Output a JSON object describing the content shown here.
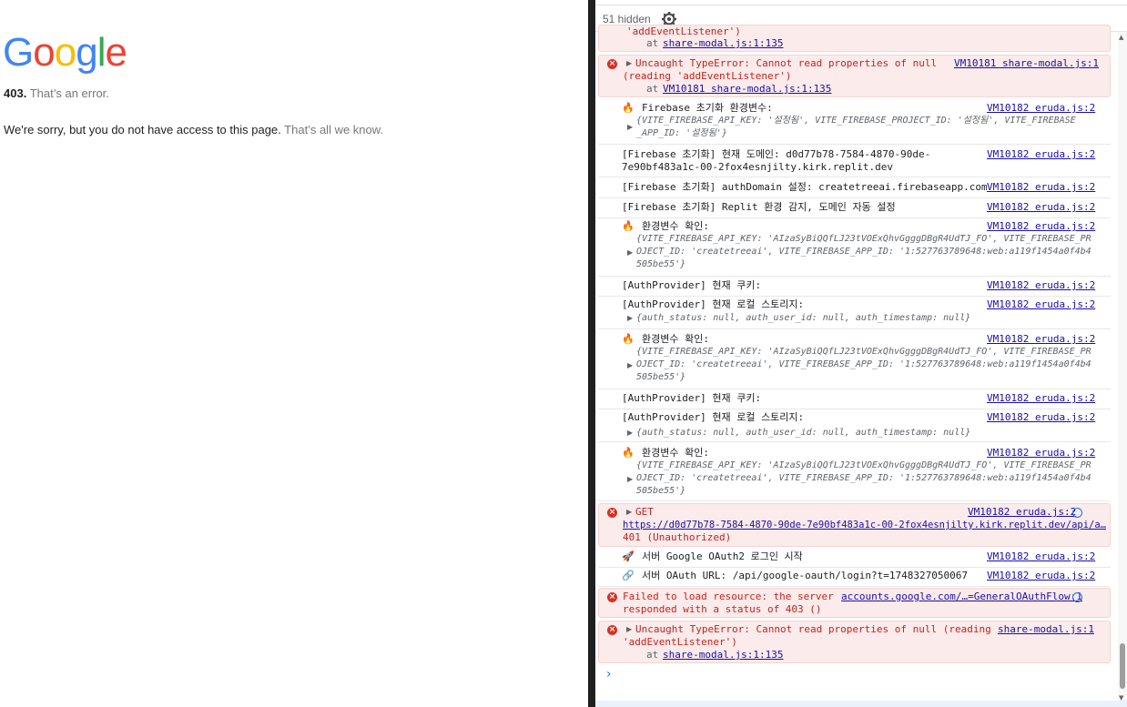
{
  "google_page": {
    "logo_letters": [
      {
        "ch": "G",
        "color": "#4285F4"
      },
      {
        "ch": "o",
        "color": "#EA4335"
      },
      {
        "ch": "o",
        "color": "#FBBC05"
      },
      {
        "ch": "g",
        "color": "#4285F4"
      },
      {
        "ch": "l",
        "color": "#34A853"
      },
      {
        "ch": "e",
        "color": "#EA4335"
      }
    ],
    "code": "403.",
    "error_text": "That’s an error.",
    "sorry_text": "We're sorry, but you do not have access to this page.",
    "all_we_know": "That’s all we know."
  },
  "devtools": {
    "hidden_count": "51 hidden",
    "prompt": "›",
    "messages": [
      {
        "lines": [
          "'addEventListener')",
          "at share-modal.js:1:135"
        ]
      },
      {
        "text1": "Uncaught TypeError: Cannot read properties of null",
        "text2": "(reading 'addEventListener')",
        "at": "at",
        "at_link": "VM10181 share-modal.js:1:135",
        "src": "VM10181 share-modal.js:1"
      },
      {
        "text": "Firebase 초기화 환경변수:",
        "obj1": "{VITE_FIREBASE_API_KEY: '설정됨', VITE_FIREBASE_PROJECT_ID: '설정됨', VITE_FIREBASE",
        "obj2": "_APP_ID: '설정됨'}",
        "src": "VM10182 eruda.js:2"
      },
      {
        "text1": "[Firebase 초기화] 현재 도메인: d0d77b78-7584-4870-90de-",
        "text2": "7e90bf483a1c-00-2fox4esnjilty.kirk.replit.dev",
        "src": "VM10182 eruda.js:2"
      },
      {
        "text": "[Firebase 초기화] authDomain 설정: createtreeai.firebaseapp.com",
        "src": "VM10182 eruda.js:2"
      },
      {
        "text": "[Firebase 초기화] Replit 환경 감지, 도메인 자동 설정",
        "src": "VM10182 eruda.js:2"
      },
      {
        "text": "환경변수 확인:",
        "obj1": "{VITE_FIREBASE_API_KEY: 'AIzaSyBiQQfLJ23tVOExQhvGgggDBgR4UdTJ_FO', VITE_FIREBASE_PR",
        "obj2": "OJECT_ID: 'createtreeai', VITE_FIREBASE_APP_ID: '1:527763789648:web:a119f1454a0f4b4",
        "obj3": "505be55'}",
        "src": "VM10182 eruda.js:2"
      },
      {
        "text": "[AuthProvider] 현재 쿠키:",
        "src": "VM10182 eruda.js:2"
      },
      {
        "text": "[AuthProvider] 현재 로컬 스토리지:",
        "obj1": "{auth_status: null, auth_user_id: null, auth_timestamp: null}",
        "src": "VM10182 eruda.js:2"
      },
      {
        "text": "환경변수 확인:",
        "obj1": "{VITE_FIREBASE_API_KEY: 'AIzaSyBiQQfLJ23tVOExQhvGgggDBgR4UdTJ_FO', VITE_FIREBASE_PR",
        "obj2": "OJECT_ID: 'createtreeai', VITE_FIREBASE_APP_ID: '1:527763789648:web:a119f1454a0f4b4",
        "obj3": "505be55'}",
        "src": "VM10182 eruda.js:2"
      },
      {
        "text": "[AuthProvider] 현재 쿠키:",
        "src": "VM10182 eruda.js:2"
      },
      {
        "text": "[AuthProvider] 현재 로컬 스토리지:",
        "obj1": "{auth_status: null, auth_user_id: null, auth_timestamp: null}",
        "src": "VM10182 eruda.js:2"
      },
      {
        "text": "환경변수 확인:",
        "obj1": "{VITE_FIREBASE_API_KEY: 'AIzaSyBiQQfLJ23tVOExQhvGgggDBgR4UdTJ_FO', VITE_FIREBASE_PR",
        "obj2": "OJECT_ID: 'createtreeai', VITE_FIREBASE_APP_ID: '1:527763789648:web:a119f1454a0f4b4",
        "obj3": "505be55'}",
        "src": "VM10182 eruda.js:2"
      },
      {
        "text": "GET",
        "url": "https://d0d77b78-7584-4870-90de-7e90bf483a1c-00-2fox4esnjilty.kirk.replit.dev/api/a…",
        "status": "401 (Unauthorized)",
        "src": "VM10182 eruda.js:2"
      },
      {
        "text": "서버 Google OAuth2 로그인 시작",
        "src": "VM10182 eruda.js:2"
      },
      {
        "text": "서버 OAuth URL: /api/google-oauth/login?t=1748327050067",
        "src": "VM10182 eruda.js:2"
      },
      {
        "text1": "Failed to load resource: the server",
        "text2": "responded with a status of 403 ()",
        "src": "accounts.google.com/…=GeneralOAuthFlow:1"
      },
      {
        "text1": "Uncaught TypeError: Cannot read properties of null (reading",
        "text2": "'addEventListener')",
        "at": "at",
        "at_link": "share-modal.js:1:135",
        "src": "share-modal.js:1"
      }
    ]
  }
}
